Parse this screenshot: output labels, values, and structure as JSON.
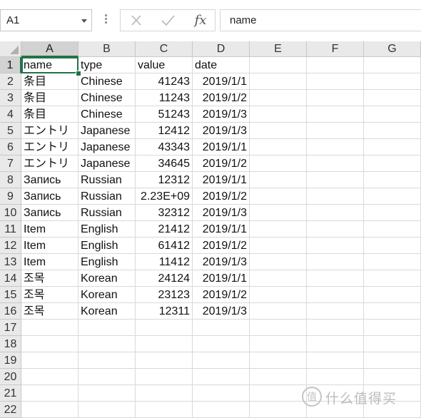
{
  "formula_bar": {
    "name_box": "A1",
    "cancel_icon": "cancel-x-icon",
    "enter_icon": "checkmark-icon",
    "fx_label": "fx",
    "formula_value": "name"
  },
  "columns": [
    "A",
    "B",
    "C",
    "D",
    "E",
    "F",
    "G"
  ],
  "row_numbers": [
    "1",
    "2",
    "3",
    "4",
    "5",
    "6",
    "7",
    "8",
    "9",
    "10",
    "11",
    "12",
    "13",
    "14",
    "15",
    "16",
    "17",
    "18",
    "19",
    "20",
    "21",
    "22"
  ],
  "rows": [
    [
      "name",
      "type",
      "value",
      "date"
    ],
    [
      "条目",
      "Chinese",
      "41243",
      "2019/1/1"
    ],
    [
      "条目",
      "Chinese",
      "11243",
      "2019/1/2"
    ],
    [
      "条目",
      "Chinese",
      "51243",
      "2019/1/3"
    ],
    [
      "エントリ",
      "Japanese",
      "12412",
      "2019/1/3"
    ],
    [
      "エントリ",
      "Japanese",
      "43343",
      "2019/1/1"
    ],
    [
      "エントリ",
      "Japanese",
      "34645",
      "2019/1/2"
    ],
    [
      "Запись",
      "Russian",
      "12312",
      "2019/1/1"
    ],
    [
      "Запись",
      "Russian",
      "2.23E+09",
      "2019/1/2"
    ],
    [
      "Запись",
      "Russian",
      "32312",
      "2019/1/3"
    ],
    [
      "Item",
      "English",
      "21412",
      "2019/1/1"
    ],
    [
      "Item",
      "English",
      "61412",
      "2019/1/2"
    ],
    [
      "Item",
      "English",
      "11412",
      "2019/1/3"
    ],
    [
      "조목",
      "Korean",
      "24124",
      "2019/1/1"
    ],
    [
      "조목",
      "Korean",
      "23123",
      "2019/1/2"
    ],
    [
      "조목",
      "Korean",
      "12311",
      "2019/1/3"
    ]
  ],
  "watermark": {
    "icon": "zhi-value-logo-icon",
    "text": "什么值得买"
  },
  "colors": {
    "accent": "#217346",
    "header_bg": "#e9e9e9",
    "gridline": "#d9d9d9"
  }
}
